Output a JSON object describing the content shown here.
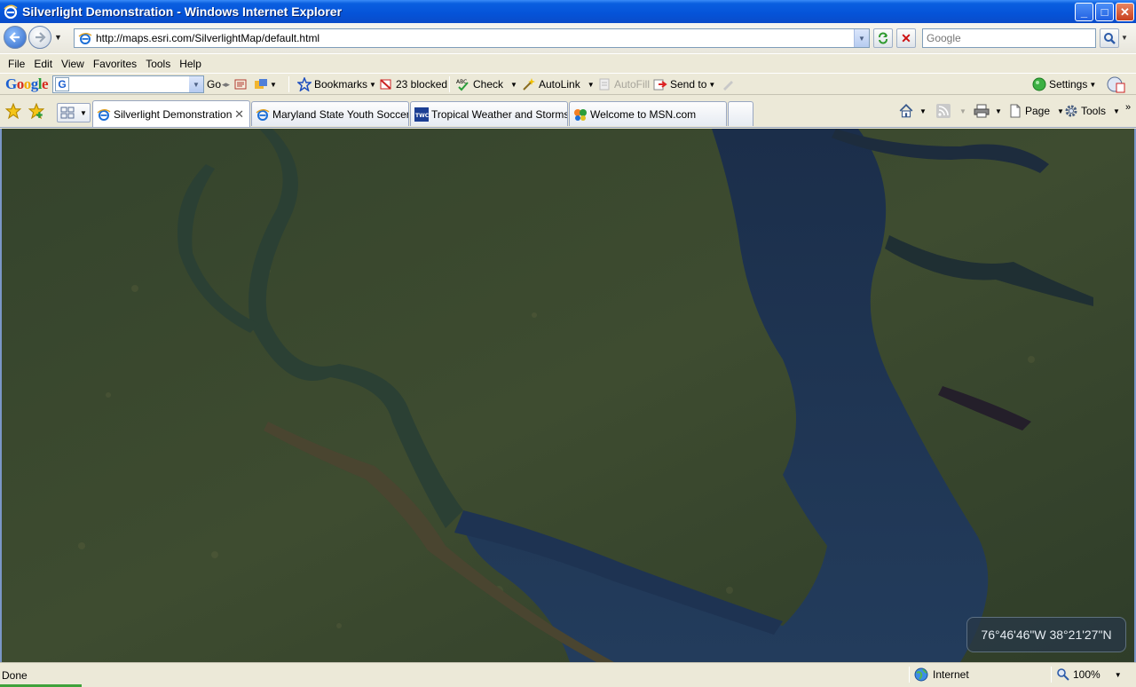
{
  "window": {
    "title": "Silverlight Demonstration - Windows Internet Explorer",
    "controls": {
      "minimize": "_",
      "maximize": "□",
      "close": "✕"
    }
  },
  "address_bar": {
    "url": "http://maps.esri.com/SilverlightMap/default.html",
    "search_placeholder": "Google"
  },
  "menu": [
    "File",
    "Edit",
    "View",
    "Favorites",
    "Tools",
    "Help"
  ],
  "google_toolbar": {
    "logo": "Google",
    "search_icon_letter": "G",
    "go_label": "Go",
    "bookmarks_label": "Bookmarks",
    "blocked_label": "23 blocked",
    "check_label": "Check",
    "autolink_label": "AutoLink",
    "autofill_label": "AutoFill",
    "sendto_label": "Send to",
    "settings_label": "Settings"
  },
  "tabs": [
    {
      "label": "Silverlight Demonstration",
      "active": true
    },
    {
      "label": "Maryland State Youth Soccer...",
      "active": false
    },
    {
      "label": "Tropical Weather and Storms...",
      "active": false
    },
    {
      "label": "Welcome to MSN.com",
      "active": false
    }
  ],
  "command_bar": {
    "page_label": "Page",
    "tools_label": "Tools"
  },
  "map": {
    "coordinates": "76°46'46\"W 38°21'27\"N",
    "colors": {
      "water": "#1f3554",
      "land": "#3b4a2f",
      "river": "#4a4530"
    }
  },
  "status": {
    "text": "Done",
    "zone": "Internet",
    "zoom": "100%"
  }
}
